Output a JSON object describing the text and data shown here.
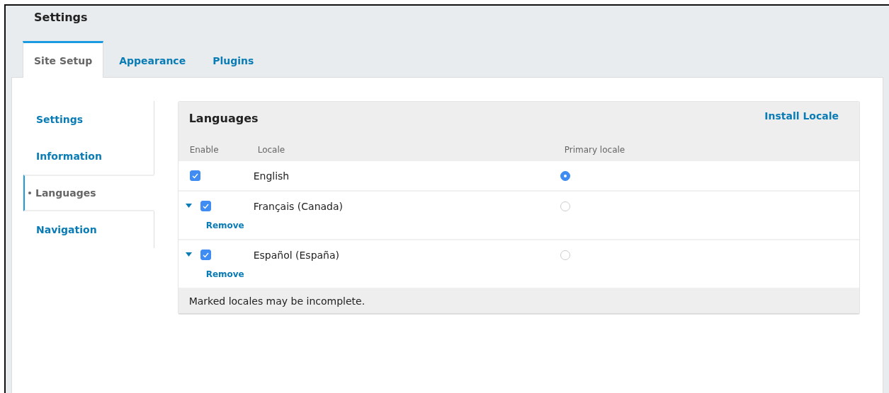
{
  "page": {
    "title": "Settings"
  },
  "tabs": [
    {
      "label": "Site Setup",
      "selected": true
    },
    {
      "label": "Appearance",
      "selected": false
    },
    {
      "label": "Plugins",
      "selected": false
    }
  ],
  "sidebar": {
    "items": [
      {
        "label": "Settings",
        "selected": false
      },
      {
        "label": "Information",
        "selected": false
      },
      {
        "label": "Languages",
        "selected": true
      },
      {
        "label": "Navigation",
        "selected": false
      }
    ]
  },
  "languages": {
    "title": "Languages",
    "install_link": "Install Locale",
    "columns": [
      "Enable",
      "Locale",
      "Primary locale"
    ],
    "rows": [
      {
        "kind": "fixed",
        "enabled": true,
        "locale": "English",
        "primary": true
      },
      {
        "kind": "removable",
        "expanded": true,
        "enabled": true,
        "locale": "Français (Canada)",
        "primary": false,
        "remove_label": "Remove"
      },
      {
        "kind": "removable",
        "expanded": true,
        "enabled": true,
        "locale": "Español (España)",
        "primary": false,
        "remove_label": "Remove"
      }
    ],
    "footer": "Marked locales may be incomplete."
  }
}
